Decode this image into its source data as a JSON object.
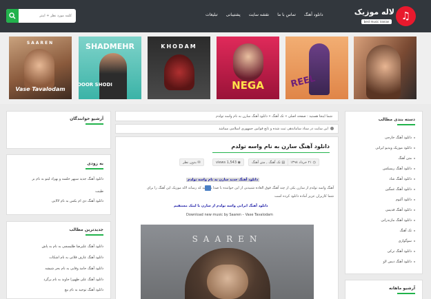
{
  "header": {
    "logo_icon": "music-note-icon",
    "site_name": "لاله موزیک",
    "site_tagline": "best music iranian",
    "nav": [
      "دانلود آهنگ",
      "تماس با ما",
      "نقشه سایت",
      "پشتیبانی",
      "تبلیغات"
    ],
    "search_placeholder": "کلمه مورد نظر + اینتر"
  },
  "covers": [
    {
      "text_top": "SAAREN",
      "text_bottom": "Vase Tavalodam"
    },
    {
      "text_top": "SHADMEHR",
      "text_bottom": "DOOR SHODI"
    },
    {
      "text_top": "KHODAM",
      "text_bottom": ""
    },
    {
      "text_top": "",
      "text_bottom": "NEGA"
    },
    {
      "text_top": "",
      "text_bottom": "REEL"
    },
    {
      "text_top": "",
      "text_bottom": ""
    }
  ],
  "breadcrumb": "شما اینجا هستید : صفحه اصلی » تک آهنگ » دانلود آهنگ سارن به نام واسه تولدم",
  "notice": "این سایت در ستاد ساماندهی ثبت شده و تابع قوانین جمهوری اسلامی میباشد",
  "post": {
    "title": "دانلود آهنگ سارن به نام واسه تولدم",
    "date": "۲۱ خرداد ۱۳۹۸",
    "category": "تک آهنگ , متن آهنگ",
    "views": "views 1,543",
    "comments": "بدون نظر",
    "highlight": "دانلود آهنگ جدید سارن به نام واسه تولدم",
    "para_line1": "آهنگ واسه تولدم از سارن یکی از چند آهنگ فوق العاده شنیدنی از این خواننده با صدا میباشد که رسانه لاله موزیک این آهنگ را برای",
    "para_line2": "شما کاربران عزیز آماده دانلود کرده است",
    "blue_line": "دانلود آهنگ ایرانی واسه تولدم از سارن با لینک مستقیم",
    "english_line": "Download new music by Saaren – Vase Tavalodam",
    "image_text": "SAAREN"
  },
  "left": {
    "archive_title": "آرشیو خوانندگان",
    "soon_title": "به زودی",
    "soon_items": [
      "دانلود آهنگ جدید سپهر خلسه و بهزاد لیتو به نام بز",
      "طینت",
      "دانلود آهنگ دی ام بکس به نام لالایی"
    ],
    "latest_title": "جدیدترین مطالب",
    "latest_items": [
      "دانلود آهنگ علیرضا طلیسچی به نام به پاش",
      "دانلود آهنگ عارف قلاتی به نام اشکات",
      "دانلود آهنگ حامد وفایی به نام بحر شیشه",
      "دانلود آهنگ علی طهورا جاوید به نام برگرد",
      "دانلود آهنگ توحید به نام بیع"
    ]
  },
  "right": {
    "cat_title": "دسته بندی مطالب",
    "cats": [
      "دانلود آهنگ خارجی",
      "دانلود موزیک ویدیو ایرانی",
      "متن آهنگ",
      "دانلود آهنگ ریمیکس",
      "دانلود آهنگ شاد",
      "دانلود آهنگ غمگین",
      "دانلود آلبوم",
      "دانلود آهنگ قدیمی",
      "دانلود آهنگ مازندرانی",
      "تک آهنگ",
      "سوگواری",
      "دانلود آهنگ ترکی",
      "دانلود آهنگ دیس لاو"
    ],
    "monthly_title": "آرشیو ماهانه"
  },
  "colors": {
    "accent": "#20b34a",
    "header": "#32373d",
    "logo": "#e9192d",
    "link": "#1a1aa6"
  }
}
